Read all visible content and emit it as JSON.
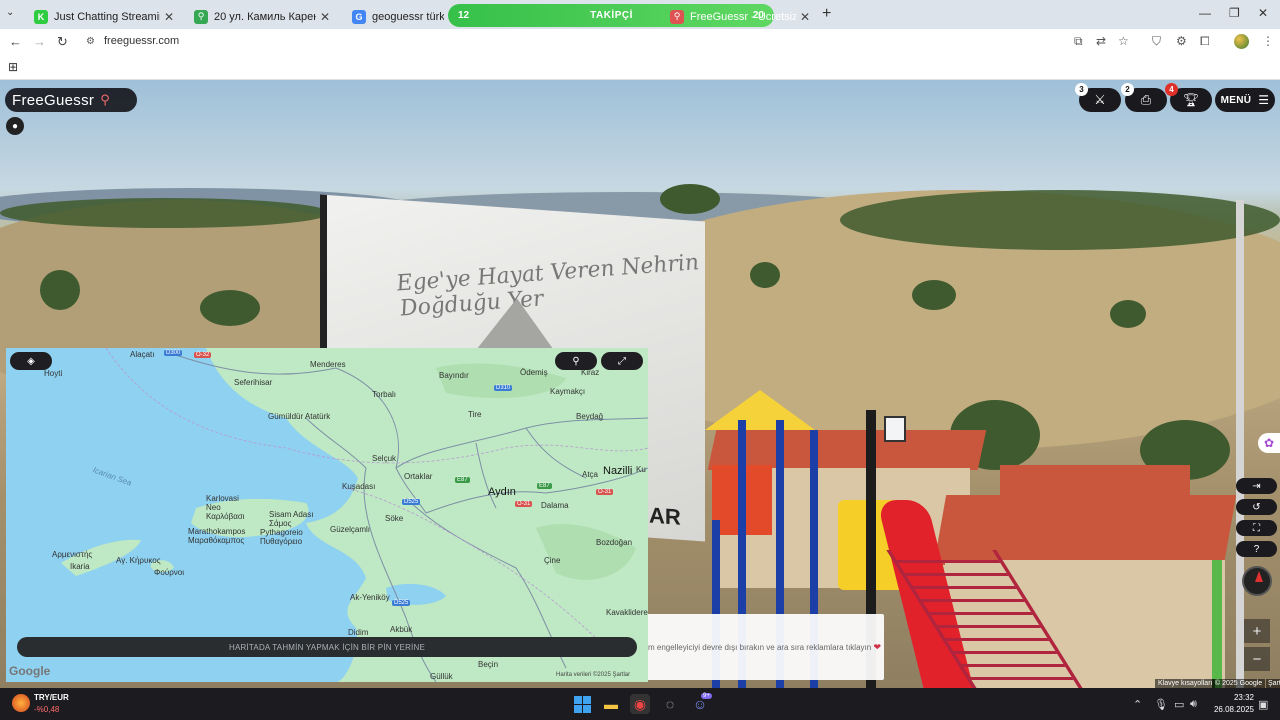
{
  "browser": {
    "tabs": [
      {
        "title": "Just Chatting Streaming - Live S",
        "fav_color": "#2ecc40",
        "fav_glyph": "K"
      },
      {
        "title": "20 ул. Камиль Карена - Google",
        "fav_color": "#34a853",
        "fav_glyph": "⚲"
      },
      {
        "title": "geoguessr türkiye benzeri",
        "fav_color": "#4285f4",
        "fav_glyph": "G"
      },
      {
        "title": "FreeGuessr - Ücretsiz GeoGue",
        "fav_color": "#e05252",
        "fav_glyph": "⚲"
      }
    ],
    "followers_overlay": {
      "count": "12",
      "label": "TAKİPÇİ",
      "extra": "20"
    },
    "url": "freeguessr.com"
  },
  "hud": {
    "logo_text": "FreeGuessr",
    "badges": {
      "duel": "3",
      "print": "2",
      "trophy": "4"
    },
    "menu_label": "MENÜ"
  },
  "map": {
    "labels": {
      "alacati": "Alaçatı",
      "menderes": "Menderes",
      "bayindir": "Bayındır",
      "odemis": "Ödemiş",
      "kiraz": "Kiraz",
      "hoyt": "Hoyti",
      "seferihisar": "Seferihisar",
      "torbali": "Torbalı",
      "kaymakci": "Kaymakçı",
      "beydag": "Beydağ",
      "tire": "Tire",
      "gumuldur": "Gümüldür Atatürk",
      "selcuk": "Selçuk",
      "ortaklar": "Ortaklar",
      "nazilli": "Nazilli",
      "kuyucak": "Ku",
      "atca": "Atça",
      "icarian": "Icarian Sea",
      "karlovasi": "Karlovasi\nNeo\nΚαρλόβασι",
      "kusadasi": "Kuşadası",
      "aydin": "Aydın",
      "dalama": "Dalama",
      "samos": "Sisam Adası\nΣάμος",
      "pythagoreio": "Pythagoreio\nΠυθαγόρειο",
      "marathokampos": "Marathokampos\nΜαραθόκαμπος",
      "guzelcamli": "Güzelçamlı",
      "soke": "Söke",
      "bozdogan": "Bozdoğan",
      "armenistis": "Αρμενιστής",
      "agkirikos": "Αγ. Κήρυκος",
      "ikaria": "Ikaria",
      "fournoi": "Φούρνοι",
      "cine": "Çine",
      "akyenikoy": "Ak-Yeniköy",
      "akbuk": "Akbük",
      "didim": "Didim",
      "kavaklidere": "Kavaklidere",
      "becin": "Beçin",
      "gulluk": "Güllük"
    },
    "road_shields": {
      "d300": "D300",
      "o32": "O-32",
      "d310": "D310",
      "e87": "E87",
      "e87b": "E87",
      "o31": "O-31",
      "o31b": "O-31",
      "d525": "D525",
      "d525b": "D525"
    },
    "guess_prompt": "HARİTADA TAHMİN YAPMAK İÇİN BİR PİN YERİNE",
    "google_logo": "Google",
    "attribution": "Harita verileri ©2025   Şartlar"
  },
  "sign": {
    "visible_text": "Ege'ye Hayat Veren Nehrin Doğduğu Yer",
    "bottom_letters": "AR"
  },
  "ad": {
    "text": "m engelleyiciyi devre dışı bırakın ve ara sıra reklamlara tıklayın"
  },
  "footer": {
    "keys": "Klavye kısayolları",
    "copyright": "© 2025 Google",
    "terms": "Şart"
  },
  "taskbar": {
    "ticker_name": "TRY/EUR",
    "ticker_value": "-%0,48",
    "discord_badge": "9+",
    "time": "23:32",
    "date": "26.08.2025"
  },
  "colors": {
    "accent_green": "#36c04a",
    "hud_dark": "#1a1a1e",
    "badge_red": "#e0302a",
    "map_land": "#bfe9c4",
    "map_water": "#8ed1f0"
  }
}
